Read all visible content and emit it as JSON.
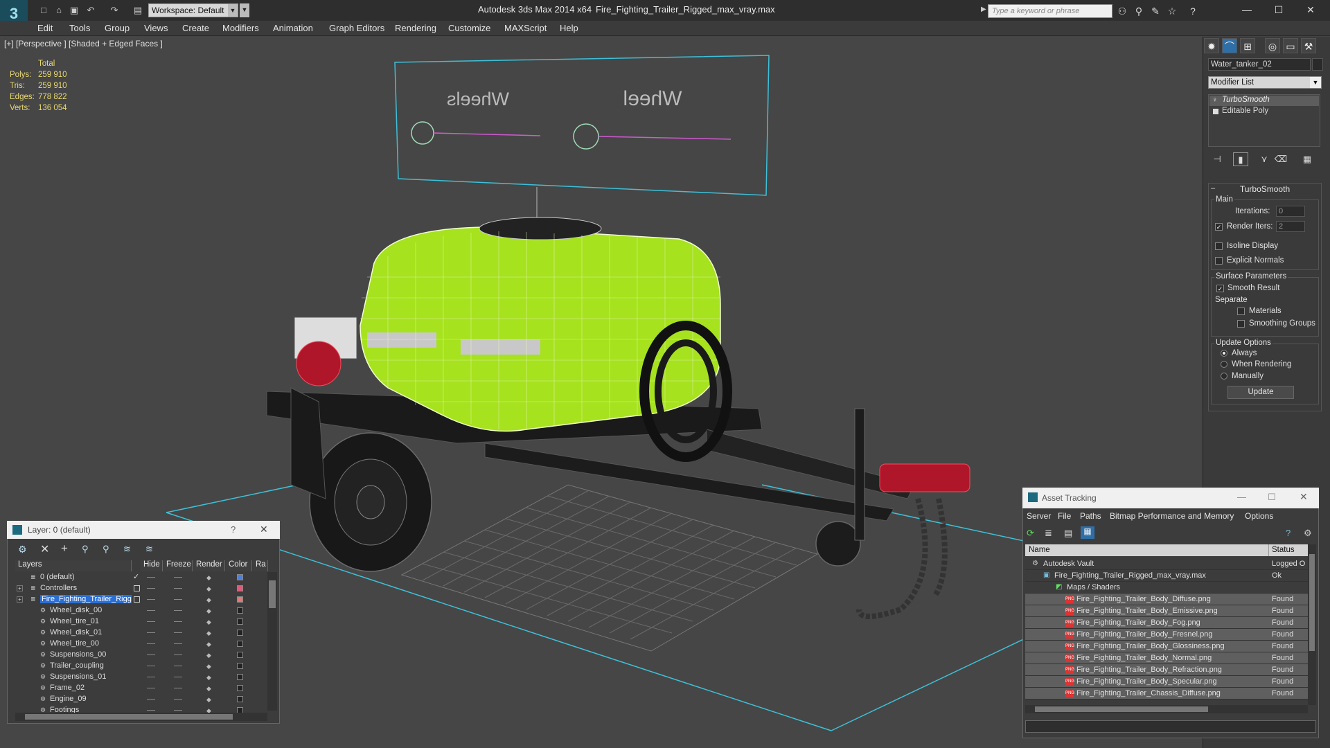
{
  "titlebar": {
    "workspace": "Workspace: Default",
    "app_title": "Autodesk 3ds Max  2014 x64",
    "file_title": "Fire_Fighting_Trailer_Rigged_max_vray.max",
    "search_placeholder": "Type a keyword or phrase"
  },
  "menu": [
    "Edit",
    "Tools",
    "Group",
    "Views",
    "Create",
    "Modifiers",
    "Animation",
    "Graph Editors",
    "Rendering",
    "Customize",
    "MAXScript",
    "Help"
  ],
  "viewport": {
    "label": "[+] [Perspective ] [Shaded + Edged Faces ]",
    "stats": {
      "header": "Total",
      "rows": [
        {
          "label": "Polys:",
          "value": "259 910"
        },
        {
          "label": "Tris:",
          "value": "259 910"
        },
        {
          "label": "Edges:",
          "value": "778 822"
        },
        {
          "label": "Verts:",
          "value": "136 054"
        }
      ]
    },
    "panel_text_left": "Wheels",
    "panel_text_right": "Wheel"
  },
  "command_panel": {
    "object_name": "Water_tanker_02",
    "modifier_list": "Modifier List",
    "stack": [
      "TurboSmooth",
      "Editable Poly"
    ],
    "rollout_title": "TurboSmooth",
    "main_group": "Main",
    "iterations_label": "Iterations:",
    "iterations_value": "0",
    "render_iters_label": "Render Iters:",
    "render_iters_value": "2",
    "isoline": "Isoline Display",
    "explicit_normals": "Explicit Normals",
    "surface_group": "Surface Parameters",
    "smooth_result": "Smooth Result",
    "separate": "Separate",
    "materials": "Materials",
    "smoothing_groups": "Smoothing Groups",
    "update_group": "Update Options",
    "always": "Always",
    "when_rendering": "When Rendering",
    "manually": "Manually",
    "update_button": "Update"
  },
  "layer_dialog": {
    "title": "Layer: 0 (default)",
    "help": "?",
    "columns": [
      "Layers",
      "Hide",
      "Freeze",
      "Render",
      "Color",
      "Ra"
    ],
    "rows": [
      {
        "name": "0 (default)",
        "color": "#4f7fdc"
      },
      {
        "name": "Controllers",
        "color": "#e05a7a"
      },
      {
        "name": "Fire_Fighting_Trailer_Rigged",
        "color": "#e07a7a"
      },
      {
        "name": "Wheel_disk_00",
        "color": "#222222"
      },
      {
        "name": "Wheel_tire_01",
        "color": "#222222"
      },
      {
        "name": "Wheel_disk_01",
        "color": "#222222"
      },
      {
        "name": "Wheel_tire_00",
        "color": "#222222"
      },
      {
        "name": "Suspensions_00",
        "color": "#222222"
      },
      {
        "name": "Trailer_coupling",
        "color": "#222222"
      },
      {
        "name": "Suspensions_01",
        "color": "#222222"
      },
      {
        "name": "Frame_02",
        "color": "#222222"
      },
      {
        "name": "Engine_09",
        "color": "#222222"
      },
      {
        "name": "Footings",
        "color": "#222222"
      }
    ]
  },
  "asset_tracking": {
    "title": "Asset Tracking",
    "menu": [
      "Server",
      "File",
      "Paths",
      "Bitmap Performance and Memory",
      "Options"
    ],
    "col_name": "Name",
    "col_status": "Status",
    "rows": [
      {
        "name": "Autodesk Vault",
        "status": "Logged O"
      },
      {
        "name": "Fire_Fighting_Trailer_Rigged_max_vray.max",
        "status": "Ok"
      },
      {
        "name": "Maps / Shaders",
        "status": ""
      },
      {
        "name": "Fire_Fighting_Trailer_Body_Diffuse.png",
        "status": "Found"
      },
      {
        "name": "Fire_Fighting_Trailer_Body_Emissive.png",
        "status": "Found"
      },
      {
        "name": "Fire_Fighting_Trailer_Body_Fog.png",
        "status": "Found"
      },
      {
        "name": "Fire_Fighting_Trailer_Body_Fresnel.png",
        "status": "Found"
      },
      {
        "name": "Fire_Fighting_Trailer_Body_Glossiness.png",
        "status": "Found"
      },
      {
        "name": "Fire_Fighting_Trailer_Body_Normal.png",
        "status": "Found"
      },
      {
        "name": "Fire_Fighting_Trailer_Body_Refraction.png",
        "status": "Found"
      },
      {
        "name": "Fire_Fighting_Trailer_Body_Specular.png",
        "status": "Found"
      },
      {
        "name": "Fire_Fighting_Trailer_Chassis_Diffuse.png",
        "status": "Found"
      }
    ]
  },
  "colors": {
    "tank_green": "#a6e21e",
    "selection_blue": "#2a6fd6",
    "stats_yellow": "#e8d870",
    "grid_cyan": "#3fc0d8"
  }
}
